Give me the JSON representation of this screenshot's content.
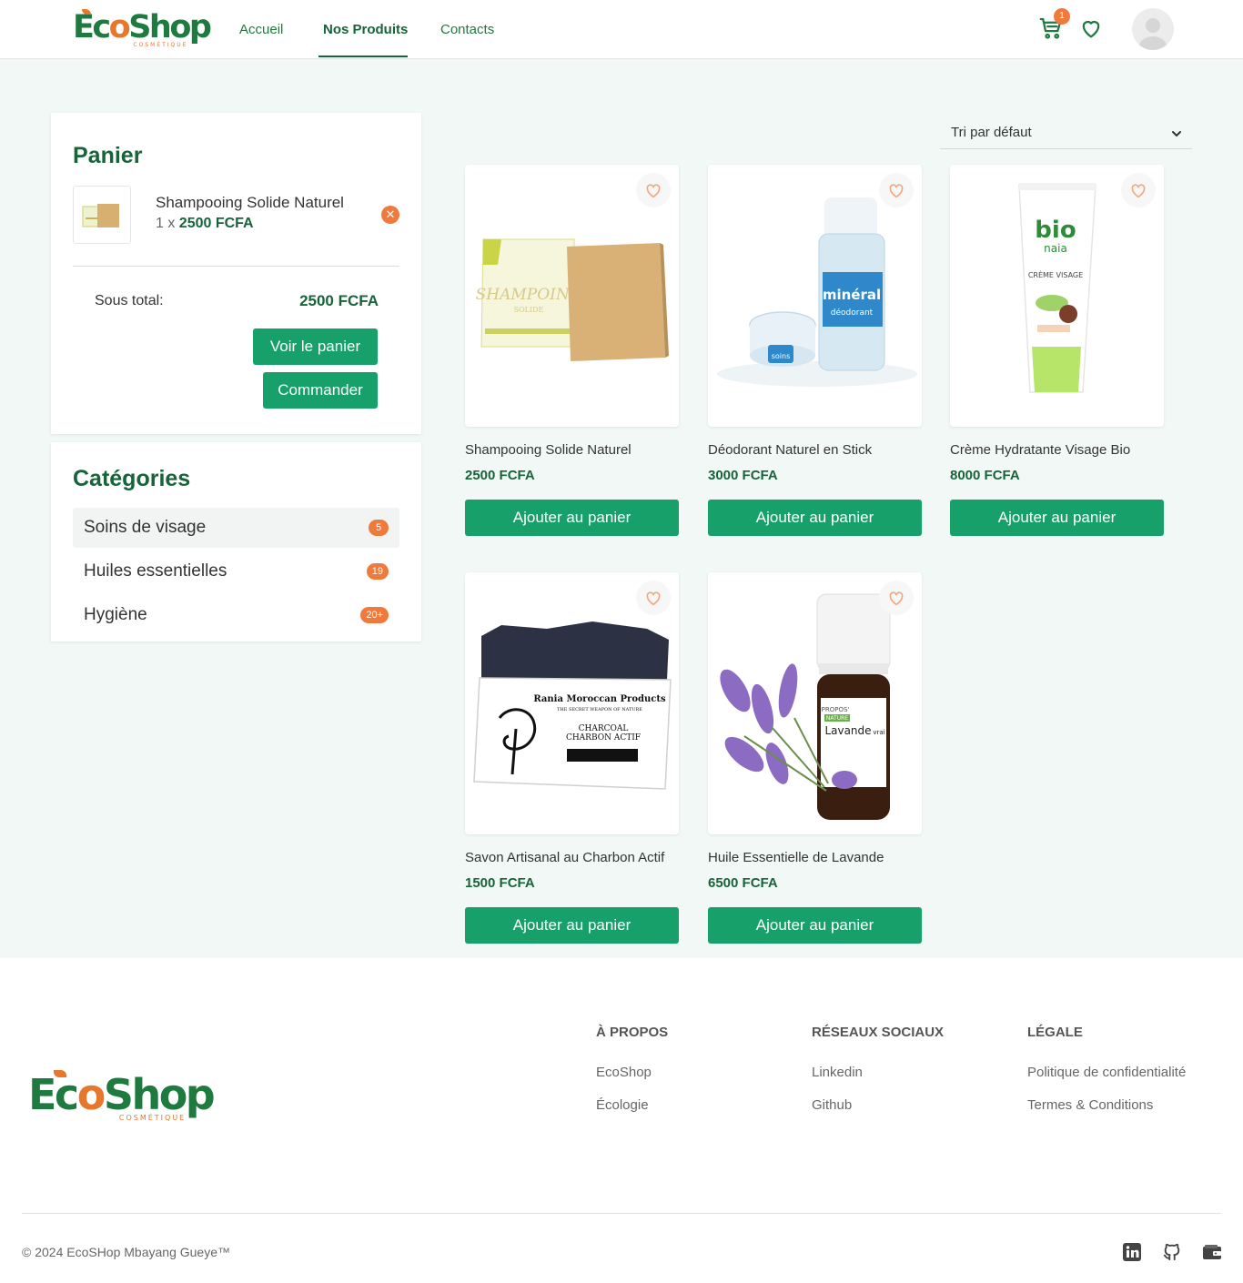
{
  "header": {
    "logo": {
      "word_start": "Ec",
      "word_o": "o",
      "word_end": "Shop",
      "sub": "COSMÉTIQUE"
    },
    "nav": [
      {
        "label": "Accueil"
      },
      {
        "label": "Nos Produits",
        "active": true
      },
      {
        "label": "Contacts"
      }
    ],
    "cart_count": "1",
    "icons": {
      "cart": "cart-icon",
      "wishlist": "heart-icon",
      "avatar": "user-avatar-icon"
    }
  },
  "cart": {
    "title": "Panier",
    "item": {
      "name": "Shampooing Solide Naturel",
      "qty_prefix": "1 x ",
      "price": "2500 FCFA"
    },
    "remove_icon": "✕",
    "subtotal_label": "Sous total:",
    "subtotal_value": "2500 FCFA",
    "view_cart_label": "Voir le panier",
    "order_label": "Commander"
  },
  "categories": {
    "title": "Catégories",
    "items": [
      {
        "name": "Soins de visage",
        "count": "5",
        "active": true
      },
      {
        "name": "Huiles essentielles",
        "count": "19"
      },
      {
        "name": "Hygiène",
        "count": "20+"
      }
    ]
  },
  "sort": {
    "selected": "Tri par défaut"
  },
  "products": [
    {
      "name": "Shampooing Solide Naturel",
      "price": "2500 FCFA",
      "add_label": "Ajouter au panier",
      "box_text": "SHAMPOING",
      "box_sub": "SOLIDE"
    },
    {
      "name": "Déodorant Naturel en Stick",
      "price": "3000 FCFA",
      "add_label": "Ajouter au panier",
      "label_text": "minéral",
      "label_sub": "déodorant",
      "cap_text": "soins"
    },
    {
      "name": "Crème Hydratante Visage Bio",
      "price": "8000 FCFA",
      "add_label": "Ajouter au panier",
      "brand": "bio",
      "brand2": "naia",
      "tube_text": "CRÈME VISAGE"
    },
    {
      "name": "Savon Artisanal au Charbon Actif",
      "price": "1500 FCFA",
      "add_label": "Ajouter au panier",
      "brand": "Rania Moroccan Products",
      "tagline": "THE SECRET WEAPON OF NATURE",
      "label": "CHARCOAL",
      "label2": "CHARBON ACTIF"
    },
    {
      "name": "Huile Essentielle de Lavande",
      "price": "6500 FCFA",
      "add_label": "Ajouter au panier",
      "brand": "PROPOS'",
      "brand2": "NATURE",
      "label": "Lavande",
      "label_end": "vrai"
    }
  ],
  "footer": {
    "columns": [
      {
        "title": "À PROPOS",
        "links": [
          "EcoShop",
          "Écologie"
        ]
      },
      {
        "title": "RÉSEAUX SOCIAUX",
        "links": [
          "Linkedin",
          "Github"
        ]
      },
      {
        "title": "LÉGALE",
        "links": [
          "Politique de confidentialité",
          "Termes & Conditions"
        ]
      }
    ],
    "copyright": "© 2024 EcoSHop Mbayang Gueye™",
    "social_icons": [
      "linkedin-icon",
      "github-icon",
      "wallet-icon"
    ]
  },
  "colors": {
    "brand_green": "#1f7a3f",
    "button_green": "#18a06b",
    "accent_orange": "#f07a3b",
    "page_bg": "#f1f8f5"
  }
}
